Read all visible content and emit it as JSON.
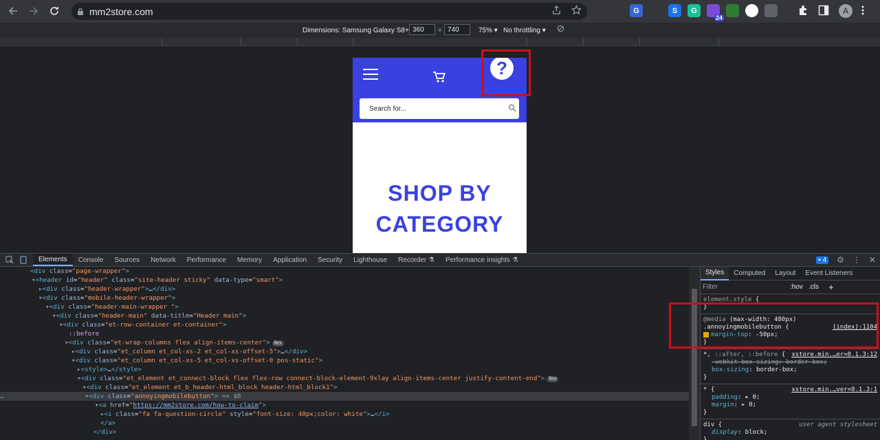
{
  "browser": {
    "url": "mm2store.com",
    "extensions": [
      {
        "name": "recycle-icon",
        "color": "#35363a",
        "label": ""
      },
      {
        "name": "globe-icon",
        "color": "#35363a",
        "label": ""
      },
      {
        "name": "translate-icon",
        "color": "#3367d6",
        "label": "G"
      },
      {
        "name": "camera-icon",
        "color": "#35363a",
        "label": ""
      },
      {
        "name": "s-extension-icon",
        "color": "#1a73e8",
        "label": "S"
      },
      {
        "name": "grammarly-icon",
        "color": "#15c39a",
        "label": "G"
      },
      {
        "name": "hexagon-extension-icon",
        "color": "#7b4bd6",
        "label": "",
        "badge": "24"
      },
      {
        "name": "wave-extension-icon",
        "color": "#2e7d32",
        "label": ""
      },
      {
        "name": "circle-s-extension-icon",
        "color": "#ffffff",
        "label": ""
      },
      {
        "name": "screen-extension-icon",
        "color": "#5f6368",
        "label": ""
      }
    ],
    "avatar_letter": "A"
  },
  "device_toolbar": {
    "dimensions_label": "Dimensions: Samsung Galaxy S8+",
    "width": "360",
    "times": "×",
    "height": "740",
    "zoom": "75%",
    "throttling": "No throttling"
  },
  "page": {
    "search_placeholder": "Search for...",
    "heading_line1": "SHOP BY",
    "heading_line2": "CATEGORY",
    "help_glyph": "?"
  },
  "devtools": {
    "tabs": [
      "Elements",
      "Console",
      "Sources",
      "Network",
      "Performance",
      "Memory",
      "Application",
      "Security",
      "Lighthouse",
      "Recorder ⚗",
      "Performance insights ⚗"
    ],
    "issues_count": "4",
    "styles_tabs": [
      "Styles",
      "Computed",
      "Layout",
      "Event Listeners"
    ],
    "filter_placeholder": "Filter",
    "hov_label": ":hov",
    "cls_label": ".cls"
  }
}
